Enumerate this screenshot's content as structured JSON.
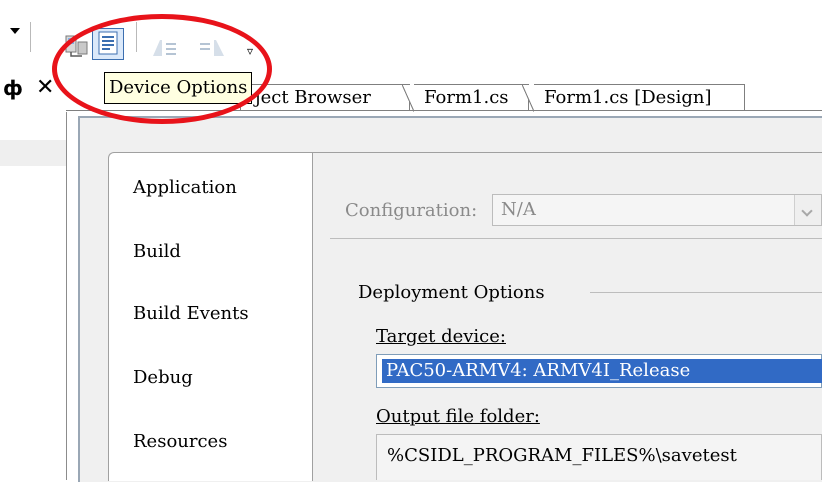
{
  "tooltip": {
    "text": "Device Options"
  },
  "toolbar": {
    "icons": [
      "dropdown-arrow",
      "device-connect-icon",
      "device-options-icon",
      "align-left-icon",
      "align-right-icon",
      "toolbar-overflow-icon"
    ]
  },
  "panel": {
    "pin_glyph": "ф",
    "close_glyph": "✕"
  },
  "tabs": [
    {
      "label": "Object Browser",
      "visible_label": "ject Browser"
    },
    {
      "label": "Form1.cs"
    },
    {
      "label": "Form1.cs [Design]"
    }
  ],
  "nav": {
    "items": [
      "Application",
      "Build",
      "Build Events",
      "Debug",
      "Resources"
    ]
  },
  "configuration": {
    "label": "Configuration:",
    "value": "N/A"
  },
  "deployment": {
    "group_label": "Deployment Options",
    "target_device_label": "Target device:",
    "target_device_value": "PAC50-ARMV4: ARMV4I_Release",
    "output_folder_label": "Output file folder:",
    "output_folder_value": "%CSIDL_PROGRAM_FILES%\\savetest"
  },
  "colors": {
    "highlight": "#e8131a",
    "selection": "#316ac5",
    "tooltip_bg": "#ffffe1"
  }
}
